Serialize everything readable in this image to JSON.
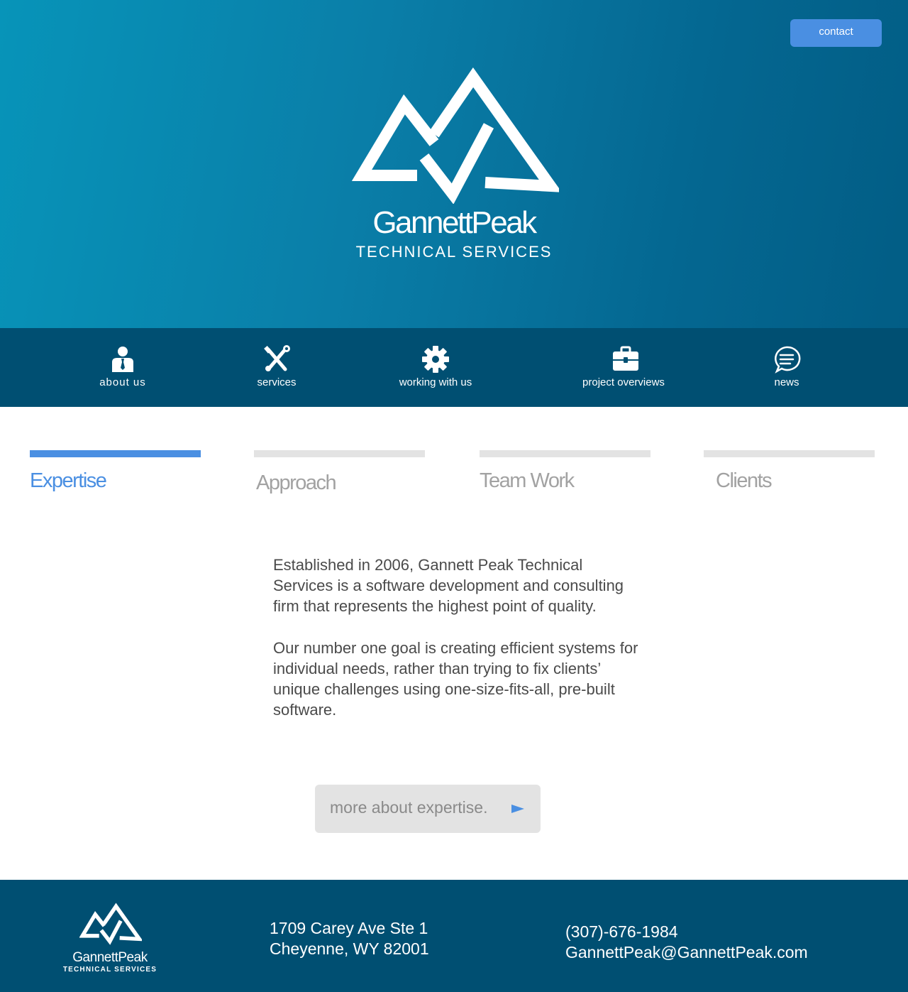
{
  "header": {
    "contact_label": "contact",
    "brand_name": "GannettPeak",
    "brand_tagline": "TECHNICAL SERVICES"
  },
  "nav": {
    "items": [
      {
        "label": "about us",
        "icon": "person-tie-icon"
      },
      {
        "label": "services",
        "icon": "tools-icon"
      },
      {
        "label": "working with us",
        "icon": "gear-icon"
      },
      {
        "label": "project overviews",
        "icon": "briefcase-icon"
      },
      {
        "label": "news",
        "icon": "chat-bubble-icon"
      }
    ]
  },
  "tabs": {
    "items": [
      {
        "label": "Expertise",
        "active": true
      },
      {
        "label": "Approach",
        "active": false
      },
      {
        "label": "Team Work",
        "active": false
      },
      {
        "label": "Clients",
        "active": false
      }
    ]
  },
  "content": {
    "paragraph_1": "Established in 2006, Gannett Peak Technical Services is a software development and consulting firm that represents the highest point of quality.",
    "paragraph_2": "Our number one goal is creating efficient systems for individual needs, rather than trying to fix clients’ unique challenges using one-size-fits-all, pre-built software.",
    "more_label": "more about expertise."
  },
  "footer": {
    "brand_name": "GannettPeak",
    "brand_tagline": "TECHNICAL SERVICES",
    "address_line_1": "1709 Carey Ave Ste 1",
    "address_line_2": "Cheyenne, WY 82001",
    "phone": "(307)-676-1984",
    "email": "GannettPeak@GannettPeak.com"
  },
  "colors": {
    "accent": "#4a8fe2",
    "nav_bg": "#004f72",
    "hero_start": "#0794b9",
    "hero_end": "#025d85",
    "tab_inactive": "#e3e3e3",
    "text_gray": "#4a4a4a"
  }
}
